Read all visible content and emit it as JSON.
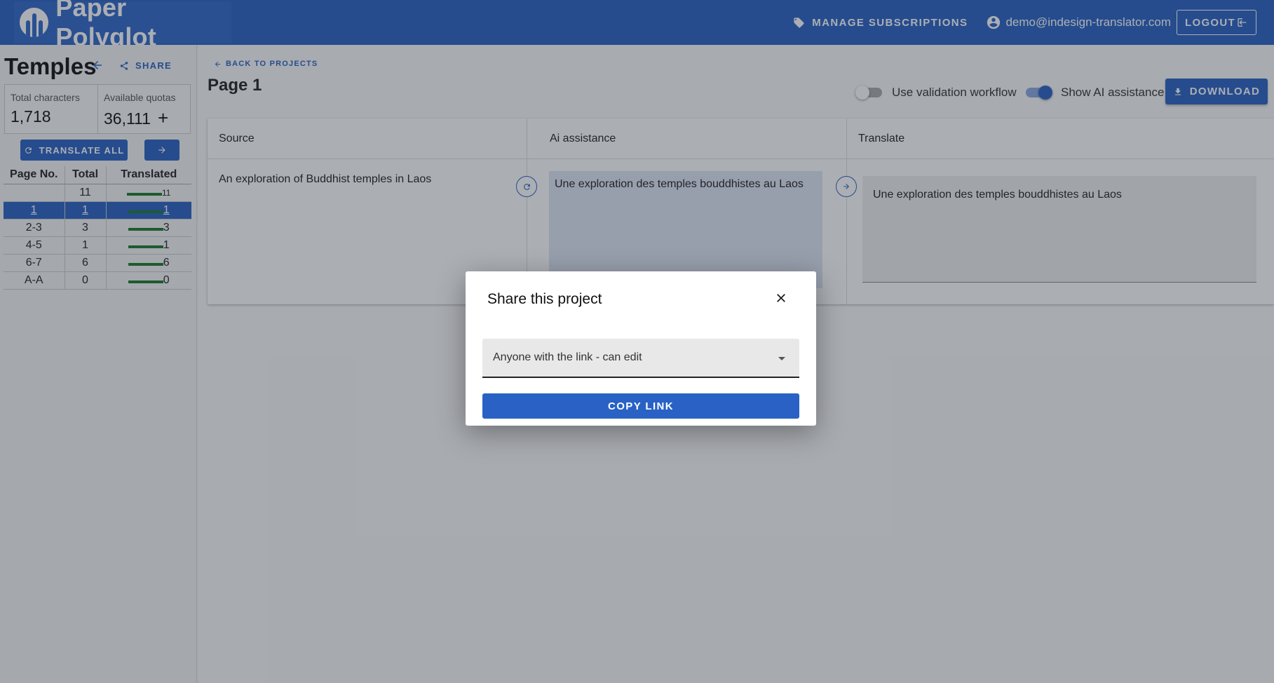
{
  "topbar": {
    "app_name": "Paper Polyglot",
    "manage_label": "MANAGE SUBSCRIPTIONS",
    "user_email": "demo@indesign-translator.com",
    "logout_label": "LOGOUT"
  },
  "sidebar": {
    "project_title": "Temples",
    "share_label": "SHARE",
    "total_chars_label": "Total characters",
    "total_chars_value": "1,718",
    "quotas_label": "Available quotas",
    "quotas_value": "36,111",
    "quotas_plus": "+",
    "translate_all_label": "TRANSLATE ALL",
    "table": {
      "headers": [
        "Page No.",
        "Total",
        "Translated"
      ],
      "rows": [
        {
          "page": "",
          "total": "11",
          "translated": "11"
        },
        {
          "page": "1",
          "total": "1",
          "translated": "1"
        },
        {
          "page": "2-3",
          "total": "3",
          "translated": "3"
        },
        {
          "page": "4-5",
          "total": "1",
          "translated": "1"
        },
        {
          "page": "6-7",
          "total": "6",
          "translated": "6"
        },
        {
          "page": "A-A",
          "total": "0",
          "translated": "0"
        }
      ]
    }
  },
  "main": {
    "back_label": "BACK TO PROJECTS",
    "page_title": "Page 1",
    "validation_label": "Use validation workflow",
    "ai_toggle_label": "Show AI assistance",
    "download_label": "DOWNLOAD",
    "columns": [
      "Source",
      "Ai assistance",
      "Translate"
    ],
    "source_text": "An exploration of Buddhist temples in Laos",
    "ai_text": "Une exploration des temples bouddhistes au Laos",
    "translate_text": "Une exploration des temples bouddhistes au Laos"
  },
  "modal": {
    "title": "Share this project",
    "select_value": "Anyone with the link - can edit",
    "copy_label": "COPY LINK"
  },
  "colors": {
    "primary": "#2962c4",
    "progress": "#1a7a2a"
  }
}
